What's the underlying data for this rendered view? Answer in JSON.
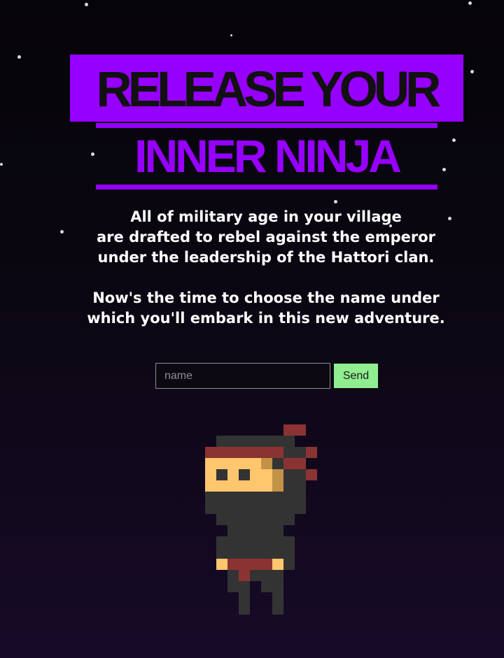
{
  "hero": {
    "title_line_1": "RELEASE YOUR",
    "title_line_2": "INNER NINJA",
    "intro_line_1": "All of military age in your village",
    "intro_line_2": "are drafted to rebel against the emperor",
    "intro_line_3": "under the leadership of the Hattori clan.",
    "choose_line_1": "Now's the time to choose the name under",
    "choose_line_2": "which you'll embark in this new adventure."
  },
  "form": {
    "name_placeholder": "name",
    "name_value": "",
    "send_label": "Send"
  },
  "colors": {
    "accent_purple": "#9600ff",
    "send_green": "#90ee90",
    "ninja_suit": "#333333",
    "ninja_red": "#8b3333",
    "ninja_skin": "#ffc66e"
  },
  "icons": {
    "ninja_sprite": "pixel-ninja-icon",
    "stars": "starfield"
  }
}
